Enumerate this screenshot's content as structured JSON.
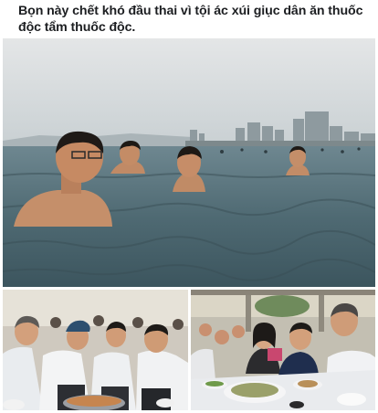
{
  "post": {
    "caption": "Bọn này chết khó đầu thai vì tội ác xúi giục dân ăn thuốc độc tẩm thuốc độc."
  },
  "photos": [
    {
      "id": "sea",
      "icon": "beach-swimmers-photo"
    },
    {
      "id": "left",
      "icon": "seafood-eating-crowd-photo"
    },
    {
      "id": "right",
      "icon": "banquet-table-photo"
    }
  ],
  "colors": {
    "sea_water": "#4f6b74",
    "sky": "#d8dde0",
    "background": "#ffffff",
    "text": "#1c1e21"
  }
}
